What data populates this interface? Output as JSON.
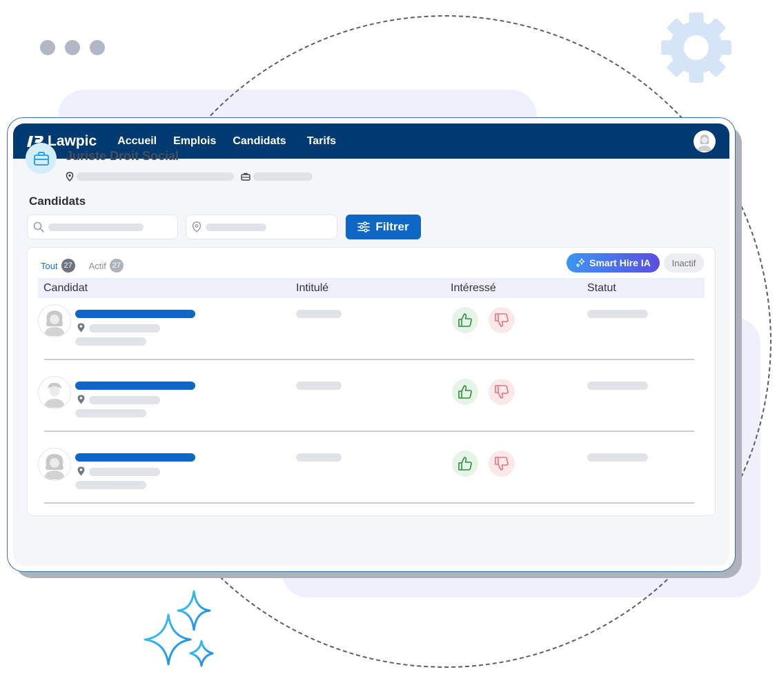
{
  "brand": {
    "name": "Lawpic"
  },
  "nav": {
    "items": [
      "Accueil",
      "Emplois",
      "Candidats",
      "Tarifs"
    ]
  },
  "job": {
    "title": "Juriste Droit Social"
  },
  "section": {
    "title": "Candidats"
  },
  "filter": {
    "label": "Filtrer"
  },
  "tabs": [
    {
      "label": "Tout",
      "count": "27"
    },
    {
      "label": "Actif",
      "count": "27"
    }
  ],
  "smart_hire": {
    "label": "Smart Hire IA"
  },
  "inactive": {
    "label": "Inactif"
  },
  "table": {
    "columns": [
      "Candidat",
      "Intitulé",
      "Intéressé",
      "Statut"
    ]
  },
  "colors": {
    "navbar": "#003a70",
    "primary": "#0f67c5",
    "thumb_up": "#2e8a3e",
    "thumb_down": "#e9707a",
    "gear": "#d6e4f7",
    "sparkle": "#2aa6e8"
  },
  "icons": {
    "job": "briefcase-icon",
    "search": "search-icon",
    "location": "location-pin-icon",
    "filter": "sliders-icon",
    "smart": "sparkle-icon",
    "up": "thumbs-up-icon",
    "down": "thumbs-down-icon",
    "settings": "gear-icon"
  }
}
